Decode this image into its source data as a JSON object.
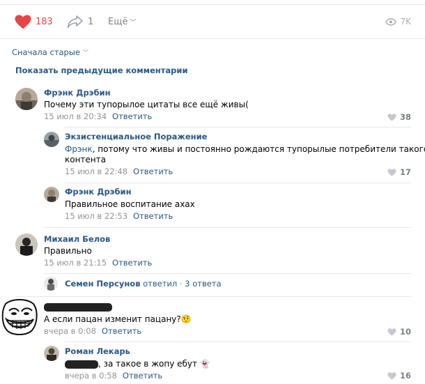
{
  "post_actions": {
    "likes": "183",
    "shares": "1",
    "more_label": "Ещё",
    "views": "7K"
  },
  "sort_label": "Сначала старые",
  "show_previous_label": "Показать предыдущие комментарии",
  "reply_label": "Ответить",
  "comments": [
    {
      "author": "Фрэнк Дрэбин",
      "text": "Почему эти тупорылое цитаты все ещё живы(",
      "time": "15 июл в 20:34",
      "likes": "38"
    },
    {
      "author": "Экзистенциальное Поражение",
      "mention": "Фрэнк",
      "text_line1": ", потому что живы и постоянно рождаются тупорылые потребители такого",
      "text_line2": "контента",
      "time": "15 июл в 22:48",
      "likes": "17"
    },
    {
      "author": "Фрэнк Дрэбин",
      "text": "Правильное воспитание ахах",
      "time": "15 июл в 22:53"
    },
    {
      "author": "Михаил Белов",
      "text": "Правильно",
      "time": "15 июл в 21:15"
    },
    {
      "thread_author": "Семен Персунов",
      "thread_action": "ответил",
      "thread_dot": "·",
      "thread_count": "3 ответа"
    },
    {
      "text": "А если пацан изменит пацану?",
      "emoji": "🤨",
      "time": "вчера в 0:08",
      "likes": "10"
    },
    {
      "author": "Роман Лекарь",
      "text": ", за такое в жопу ебут",
      "emoji": "👻",
      "time": "вчера в 0:58",
      "likes": "16"
    }
  ],
  "colors": {
    "link": "#2a5885",
    "like_red": "#e64646",
    "meta_gray": "#939393"
  }
}
